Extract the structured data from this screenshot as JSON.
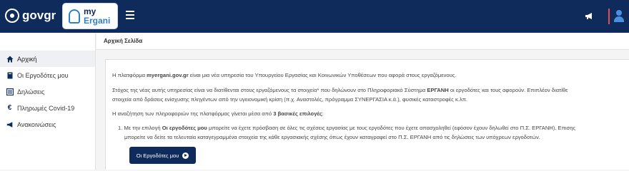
{
  "header": {
    "brand": "govgr",
    "logo_top": "my",
    "logo_bottom": "Ergani",
    "menu_icon": "hamburger-icon",
    "notification_icon": "megaphone-icon",
    "user_icon": "user-icon"
  },
  "sidebar": {
    "items": [
      {
        "label": "Αρχική",
        "icon": "home-icon",
        "active": true
      },
      {
        "label": "Οι Εργοδότες μου",
        "icon": "book-icon",
        "active": false
      },
      {
        "label": "Δηλώσεις",
        "icon": "list-icon",
        "active": false
      },
      {
        "label": "Πληρωμές Covid-19",
        "icon": "euro-icon",
        "active": false
      },
      {
        "label": "Ανακοινώσεις",
        "icon": "megaphone-icon",
        "active": false
      }
    ]
  },
  "breadcrumb": "Αρχική Σελίδα",
  "content": {
    "p1_a": "Η πλατφόρμα ",
    "p1_b": "myergani.gov.gr",
    "p1_c": " είναι μια νέα υπηρεσία του Υπουργείου Εργασίας και Κοινωνικών Υποθέσεων που αφορά στους εργαζόμενους.",
    "p2_l1_a": "Στόχος της νέας αυτής υπηρεσίας είναι να διατίθενται στους εργαζόμενους τα στοιχεία* που δηλώνουν στο Πληροφοριακό Σύστημα ",
    "p2_l1_b": "ΕΡΓΑΝΗ",
    "p2_l1_c": " οι εργοδότες και τους αφορούν. Επιπλέον διατίθε",
    "p2_l2": "στοιχεία από δράσεις ενίσχυσης πληγέντων από την υγειονομική κρίση (π.χ. Αναστολές, πρόγραμμα ΣΥΝΕΡΓΑΣΙΑ κ.ά.), φυσικές καταστροφές κ.λπ.",
    "p3_a": "Η αναζήτηση των πληροφοριών της πλατφόρμας γίνεται μέσα από ",
    "p3_b": "3 βασικές επιλογές",
    "p3_c": ":",
    "li1_l1_a": "1. Με την επιλογή ",
    "li1_l1_b": "Οι εργοδότες μου",
    "li1_l1_c": " μπορείτε να έχετε πρόσβαση σε όλες τις σχέσεις εργασίας με τους εργοδότες που έχετε απασχοληθεί (εφόσον έχουν δηλωθεί στο Π.Σ. ΕΡΓΑΝΗ). Επισης",
    "li1_l2": "μπορείτε να δείτε τα τελευταία καταγεγραμμένα στοιχεία της κάθε εργασιακής σχέσης όπως έχουν καταγραφεί στο Π.Σ. ΕΡΓΑΝΗ από τις δηλώσεις των υπόχρεων εργοδοτών.",
    "button": "Οι Εργοδότες μου"
  },
  "colors": {
    "navy": "#0e2b5c",
    "accent_blue": "#2e7fc7",
    "user_red": "#e84b4b"
  }
}
